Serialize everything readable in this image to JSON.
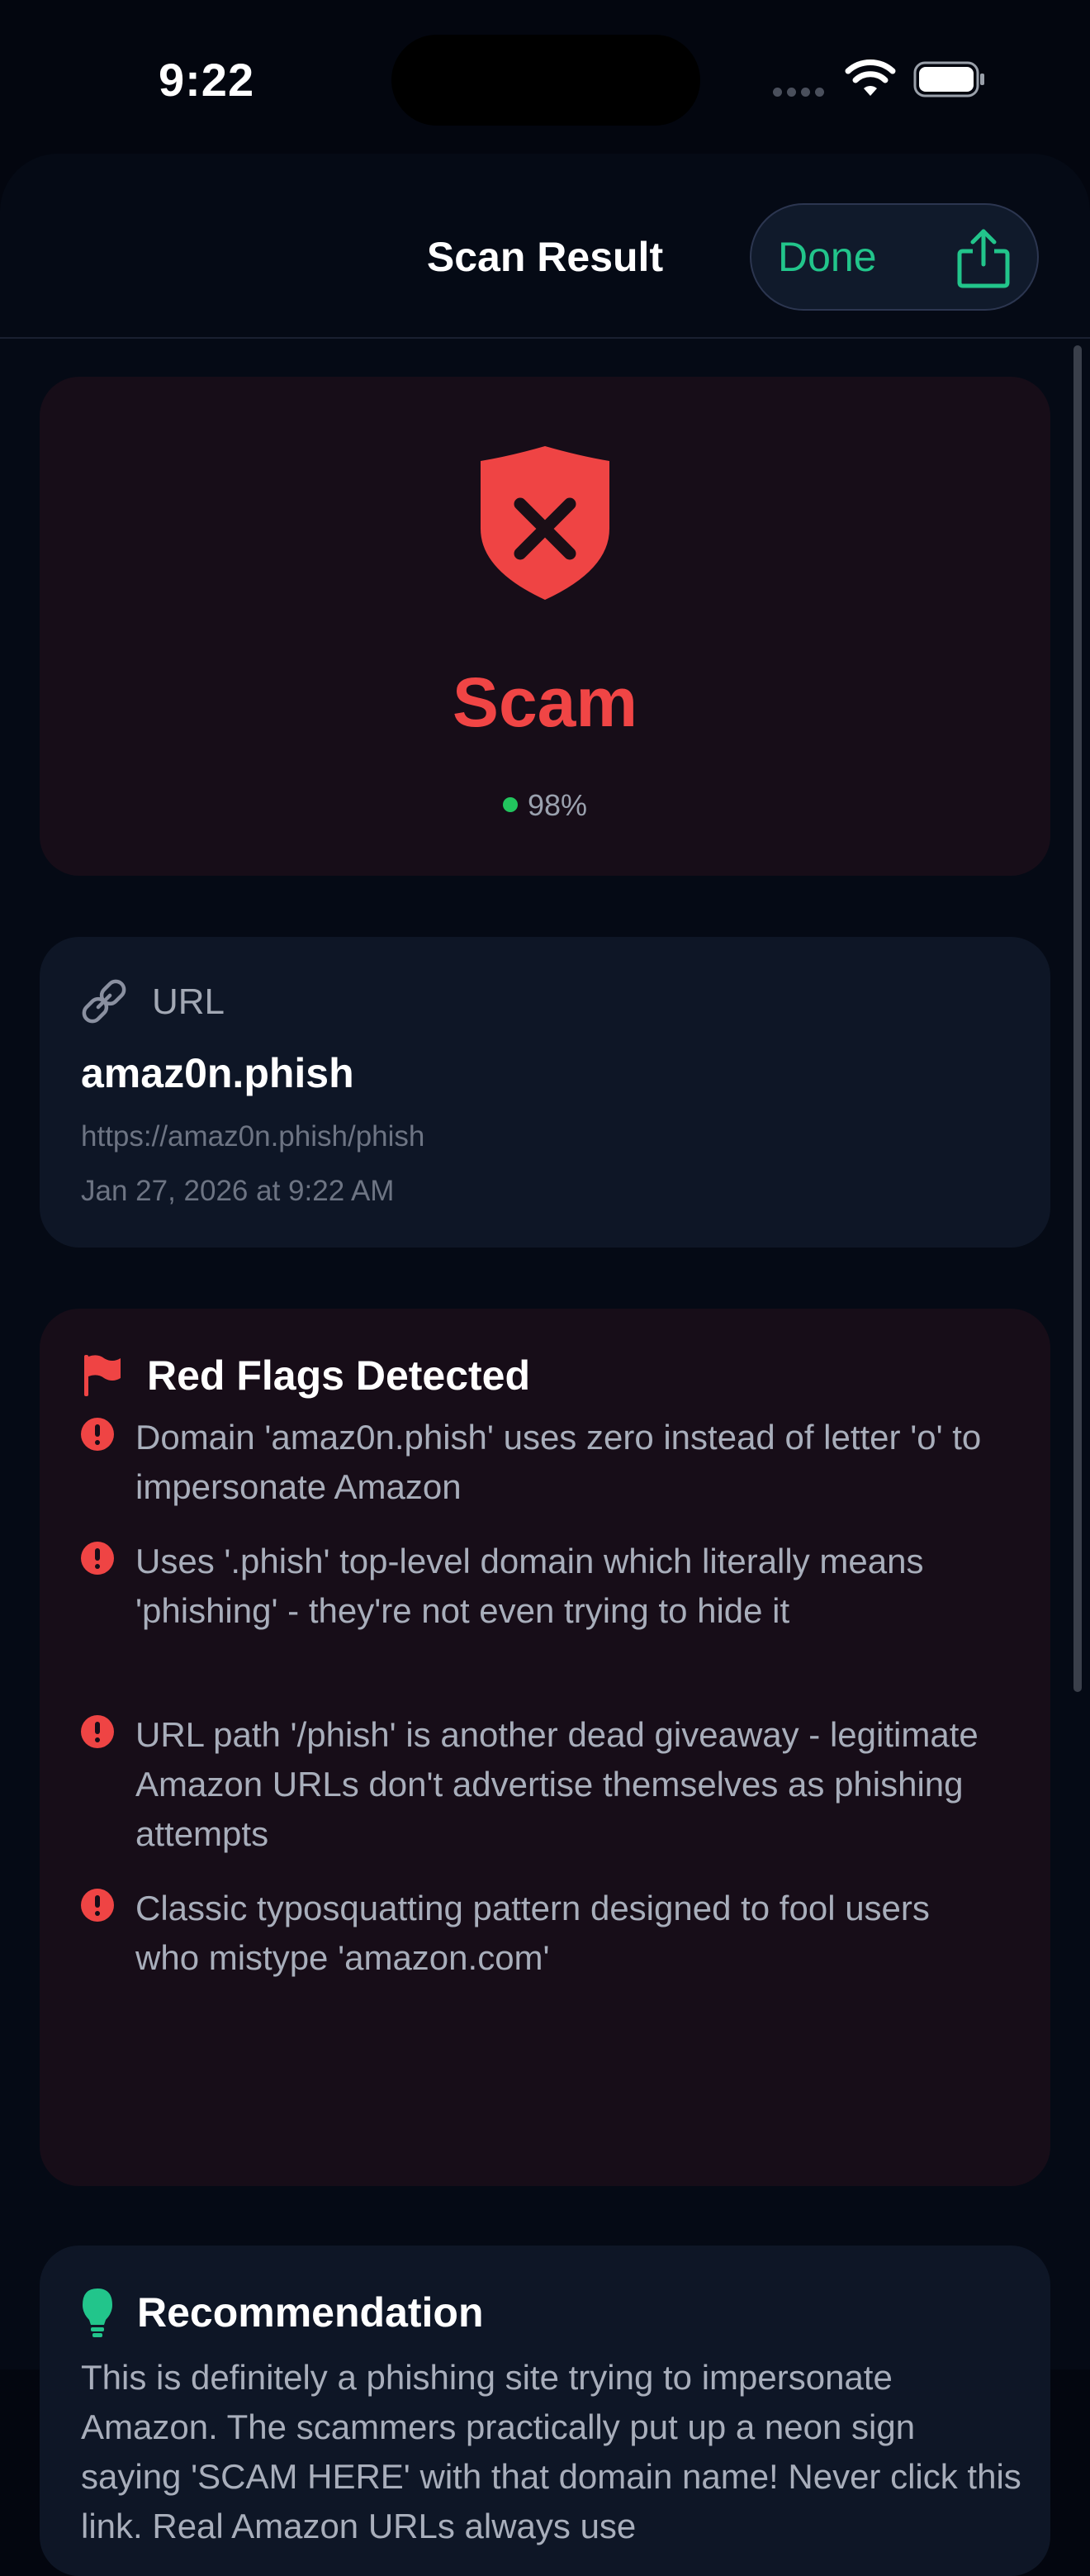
{
  "status_bar": {
    "time": "9:22"
  },
  "nav": {
    "title": "Scan Result",
    "done_label": "Done",
    "share_icon": "share-icon"
  },
  "verdict": {
    "label": "Scam",
    "confidence": "98%",
    "color": "#f04545",
    "icon": "shield-x-icon"
  },
  "url_card": {
    "label": "URL",
    "domain": "amaz0n.phish",
    "full_url": "https://amaz0n.phish/phish",
    "timestamp": "Jan 27, 2026 at 9:22 AM"
  },
  "red_flags": {
    "title": "Red Flags Detected",
    "items": [
      "Domain 'amaz0n.phish' uses zero instead of letter 'o' to impersonate Amazon",
      "Uses '.phish' top-level domain which literally means 'phishing' - they're not even trying to hide it",
      "URL path '/phish' is another dead giveaway - legitimate Amazon URLs don't advertise themselves as phishing attempts",
      "Classic typosquatting pattern designed to fool users who mistype 'amazon.com'"
    ]
  },
  "recommendation": {
    "title": "Recommendation",
    "text": "This is definitely a phishing site trying to impersonate Amazon. The scammers practically put up a neon sign saying 'SCAM HERE' with that domain name! Never click this link. Real Amazon URLs always use"
  },
  "colors": {
    "accent": "#22c58b",
    "danger": "#ef4444",
    "success": "#22c55e"
  }
}
